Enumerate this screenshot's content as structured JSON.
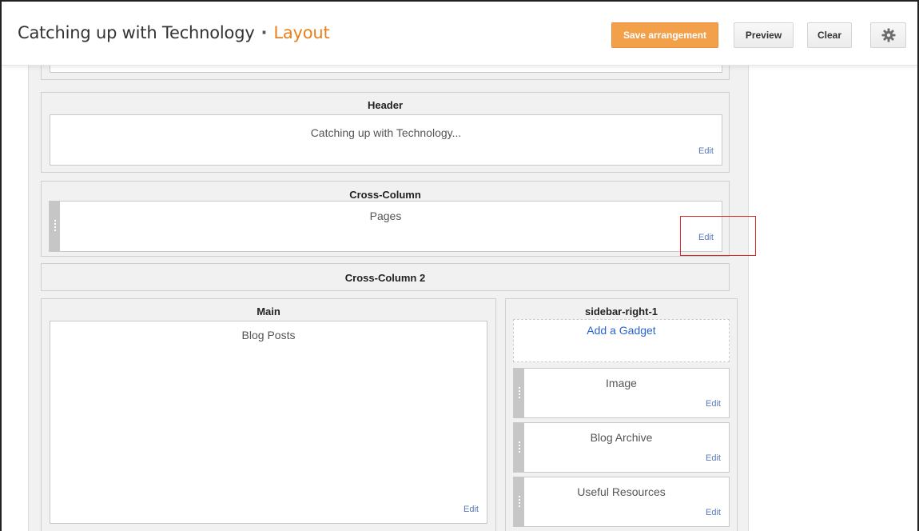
{
  "header": {
    "blog_title": "Catching up with Technology",
    "separator": "·",
    "page": "Layout",
    "buttons": {
      "save": "Save arrangement",
      "preview": "Preview",
      "clear": "Clear",
      "settings_icon": "gear-icon"
    }
  },
  "colors": {
    "accent": "#e8811c",
    "save_button": "#f2a14a",
    "link": "#2a64c9",
    "edit_link": "#5b7ab8",
    "highlight": "#d92b2b"
  },
  "layout": {
    "header_section": {
      "title": "Header",
      "widget": {
        "name": "Catching up with Technology...",
        "edit": "Edit"
      }
    },
    "cross_column": {
      "title": "Cross-Column",
      "widget": {
        "name": "Pages",
        "edit": "Edit"
      }
    },
    "cross_column_2": {
      "title": "Cross-Column 2"
    },
    "main": {
      "title": "Main",
      "widget": {
        "name": "Blog Posts",
        "edit": "Edit"
      }
    },
    "sidebar": {
      "title": "sidebar-right-1",
      "add_gadget": "Add a Gadget",
      "widgets": [
        {
          "name": "Image",
          "edit": "Edit"
        },
        {
          "name": "Blog Archive",
          "edit": "Edit"
        },
        {
          "name": "Useful Resources",
          "edit": "Edit"
        }
      ]
    }
  }
}
